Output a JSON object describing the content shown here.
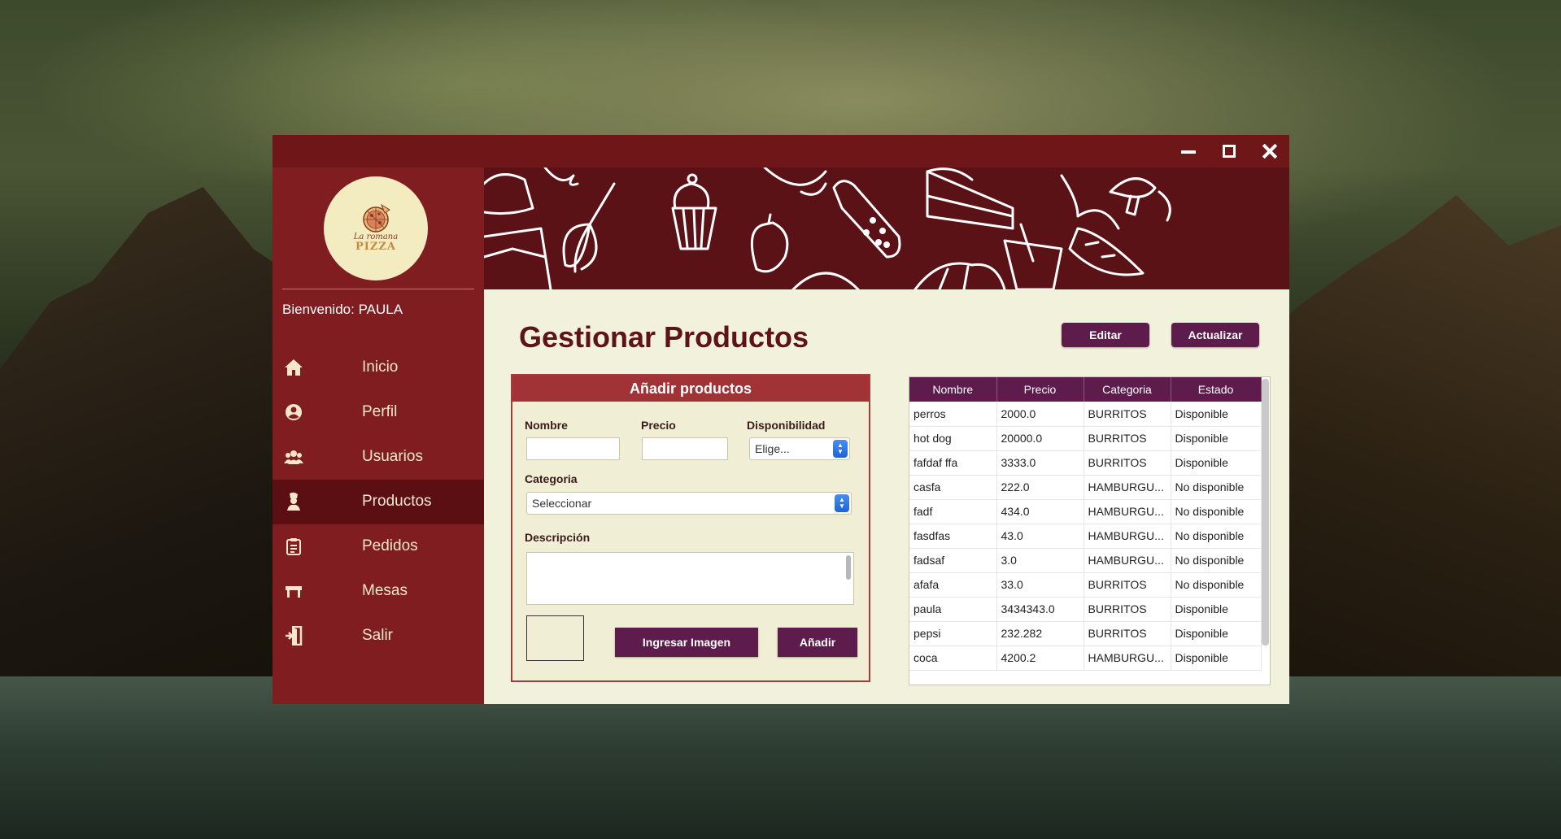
{
  "window": {
    "controls": {
      "minimize": "minimize-icon",
      "maximize": "maximize-icon",
      "close": "close-icon"
    }
  },
  "sidebar": {
    "logo": {
      "script": "La romana",
      "word": "PIZZA"
    },
    "welcome": "Bienvenido: PAULA",
    "items": [
      {
        "label": "Inicio",
        "icon": "home-icon"
      },
      {
        "label": "Perfil",
        "icon": "user-icon"
      },
      {
        "label": "Usuarios",
        "icon": "users-icon"
      },
      {
        "label": "Productos",
        "icon": "chef-icon",
        "active": true
      },
      {
        "label": "Pedidos",
        "icon": "clipboard-icon"
      },
      {
        "label": "Mesas",
        "icon": "table-icon"
      },
      {
        "label": "Salir",
        "icon": "exit-icon"
      }
    ]
  },
  "main": {
    "title": "Gestionar Productos",
    "edit_label": "Editar",
    "update_label": "Actualizar",
    "form": {
      "header": "Añadir productos",
      "name_label": "Nombre",
      "price_label": "Precio",
      "availability_label": "Disponibilidad",
      "availability_value": "Elige...",
      "category_label": "Categoria",
      "category_value": "Seleccionar",
      "description_label": "Descripción",
      "image_button": "Ingresar Imagen",
      "add_button": "Añadir"
    },
    "table": {
      "columns": [
        "Nombre",
        "Precio",
        "Categoria",
        "Estado"
      ],
      "rows": [
        [
          "perros",
          "2000.0",
          "BURRITOS",
          "Disponible"
        ],
        [
          "hot dog",
          "20000.0",
          "BURRITOS",
          "Disponible"
        ],
        [
          "fafdaf ffa",
          "3333.0",
          "BURRITOS",
          "Disponible"
        ],
        [
          "casfa",
          "222.0",
          "HAMBURGU...",
          "No disponible"
        ],
        [
          "fadf",
          "434.0",
          "HAMBURGU...",
          "No disponible"
        ],
        [
          "fasdfas",
          "43.0",
          "HAMBURGU...",
          "No disponible"
        ],
        [
          "fadsaf",
          "3.0",
          "HAMBURGU...",
          "No disponible"
        ],
        [
          "afafa",
          "33.0",
          "BURRITOS",
          "No disponible"
        ],
        [
          "paula",
          "3434343.0",
          "BURRITOS",
          "Disponible"
        ],
        [
          "pepsi",
          "232.282",
          "BURRITOS",
          "Disponible"
        ],
        [
          "coca",
          "4200.2",
          "HAMBURGU...",
          "Disponible"
        ]
      ]
    }
  },
  "colors": {
    "sidebar": "#7f1d20",
    "sidebar_active": "#5b0f12",
    "accent_purple": "#5d1c4c",
    "content_bg": "#f2f1db",
    "title": "#5c1417"
  }
}
